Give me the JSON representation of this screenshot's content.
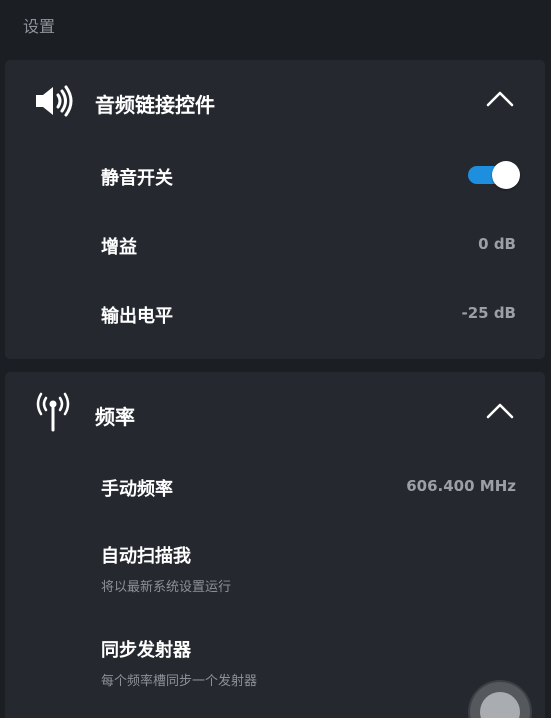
{
  "page": {
    "title": "设置"
  },
  "audio_section": {
    "icon": "speaker-icon",
    "title": "音频链接控件",
    "expanded": true,
    "rows": {
      "mute": {
        "label": "静音开关",
        "toggle_on": true
      },
      "gain": {
        "label": "增益",
        "value": "0 dB"
      },
      "output_level": {
        "label": "输出电平",
        "value": "-25 dB"
      }
    }
  },
  "frequency_section": {
    "icon": "antenna-icon",
    "title": "频率",
    "expanded": true,
    "rows": {
      "manual_frequency": {
        "label": "手动频率",
        "value": "606.400 MHz"
      },
      "auto_scan": {
        "label": "自动扫描我",
        "description": "将以最新系统设置运行"
      },
      "sync_transmitter": {
        "label": "同步发射器",
        "description": "每个频率槽同步一个发射器"
      }
    }
  },
  "colors": {
    "background": "#1b1e23",
    "card": "#25292f",
    "accent": "#1e8fde",
    "secondary_text": "#9aa0a6"
  }
}
